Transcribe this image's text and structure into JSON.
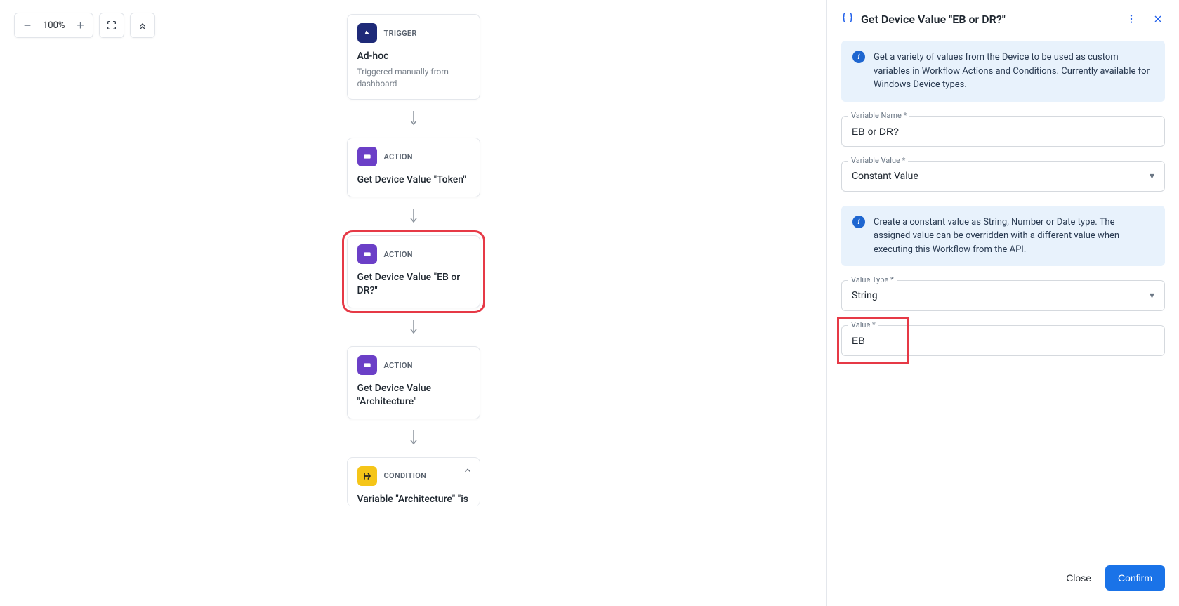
{
  "toolbar": {
    "zoom_label": "100%"
  },
  "flow": [
    {
      "type_label": "TRIGGER",
      "title": "Ad-hoc",
      "desc": "Triggered manually from dashboard",
      "icon": "trigger"
    },
    {
      "type_label": "ACTION",
      "title": "Get Device Value \"Token\"",
      "icon": "action"
    },
    {
      "type_label": "ACTION",
      "title": "Get Device Value \"EB or DR?\"",
      "icon": "action",
      "selected": true
    },
    {
      "type_label": "ACTION",
      "title": "Get Device Value \"Architecture\"",
      "icon": "action"
    },
    {
      "type_label": "CONDITION",
      "title": "Variable \"Architecture\" \"is",
      "icon": "condition",
      "collapsible": true,
      "cut": true
    }
  ],
  "panel": {
    "title": "Get Device Value \"EB or DR?\"",
    "info1": "Get a variety of values from the Device to be used as custom variables in Workflow Actions and Conditions. Currently available for Windows Device types.",
    "fields": {
      "var_name_label": "Variable Name *",
      "var_name_value": "EB or DR?",
      "var_value_label": "Variable Value *",
      "var_value_value": "Constant Value"
    },
    "info2": "Create a constant value as String, Number or Date type. The assigned value can be overridden with a different value when executing this Workflow from the API.",
    "fields2": {
      "value_type_label": "Value Type *",
      "value_type_value": "String",
      "value_label": "Value *",
      "value_value": "EB"
    },
    "footer": {
      "close": "Close",
      "confirm": "Confirm"
    }
  }
}
